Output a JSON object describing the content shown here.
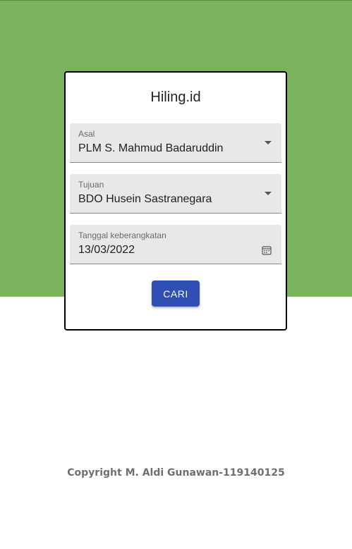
{
  "app": {
    "title": "Hiling.id"
  },
  "form": {
    "origin": {
      "label": "Asal",
      "value": "PLM S. Mahmud Badaruddin",
      "icon": "caret-down-icon"
    },
    "destination": {
      "label": "Tujuan",
      "value": "BDO Husein Sastranegara",
      "icon": "caret-down-icon"
    },
    "departure_date": {
      "label": "Tanggal keberangkatan",
      "value": "13/03/2022",
      "icon": "calendar-icon"
    },
    "search_button": {
      "label": "CARI"
    }
  },
  "footer": {
    "copyright": "Copyright M. Aldi Gunawan-119140125"
  },
  "colors": {
    "header_bg": "#7ab25e",
    "button_bg": "#2f4fb4",
    "field_bg": "#e8e8e8"
  }
}
